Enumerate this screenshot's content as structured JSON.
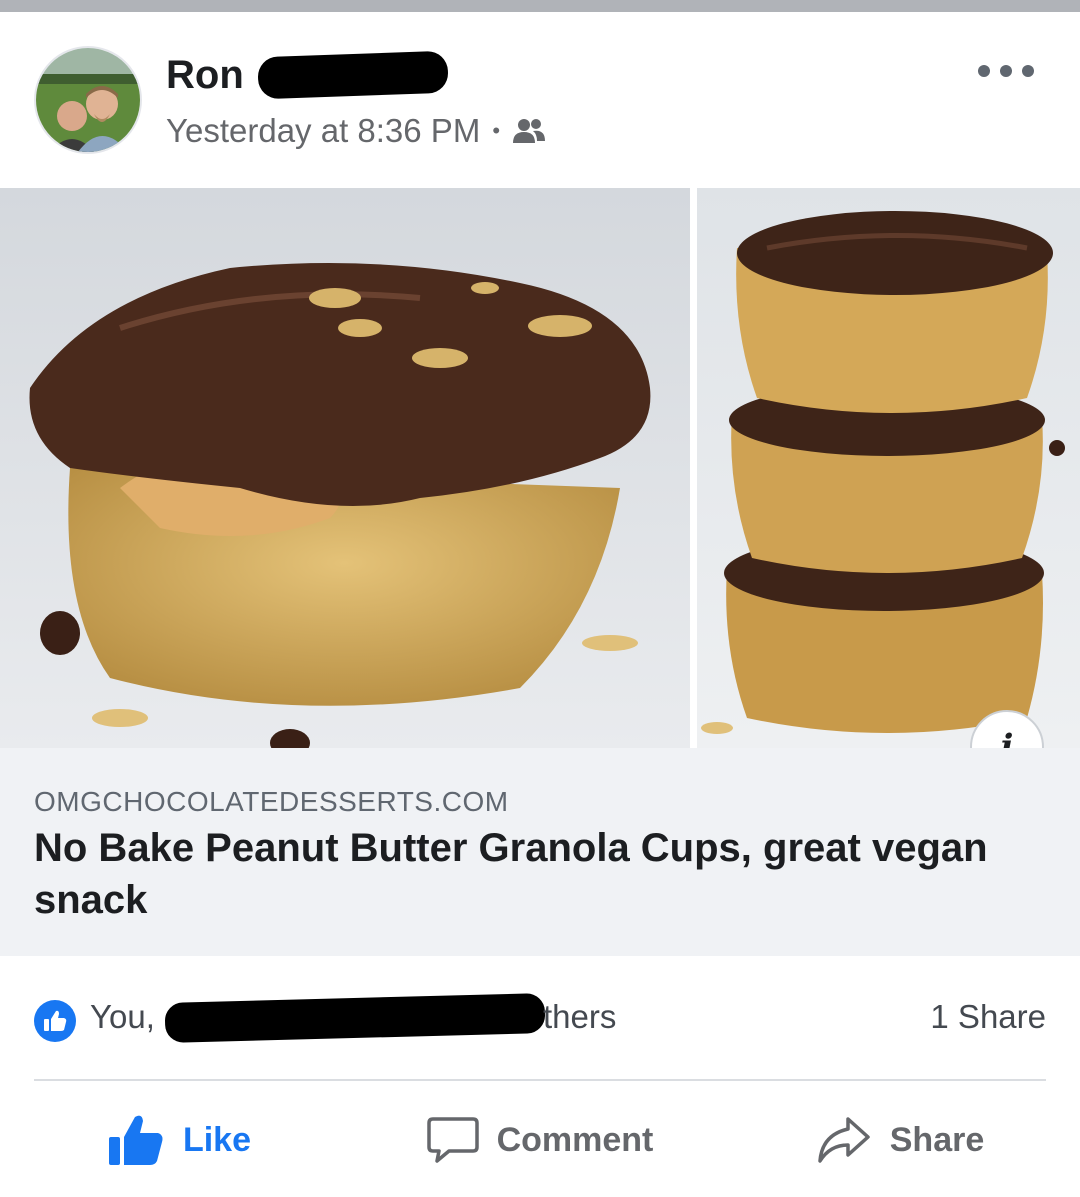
{
  "post": {
    "author_name": "Ron",
    "timestamp": "Yesterday at 8:36 PM",
    "audience_icon": "friends-icon",
    "more_icon": "more-options-icon"
  },
  "link_preview": {
    "domain": "OMGCHOCOLATEDESSERTS.COM",
    "title": "No Bake Peanut Butter Granola Cups, great vegan snack",
    "info_label": "i"
  },
  "engagement": {
    "reactions_prefix": "You,",
    "reactions_suffix": "thers",
    "shares": "1 Share"
  },
  "actions": {
    "like_label": "Like",
    "comment_label": "Comment",
    "share_label": "Share"
  },
  "colors": {
    "accent": "#1877f2",
    "text_primary": "#1c1e21",
    "text_secondary": "#65676b",
    "link_bg": "#f0f2f5"
  }
}
